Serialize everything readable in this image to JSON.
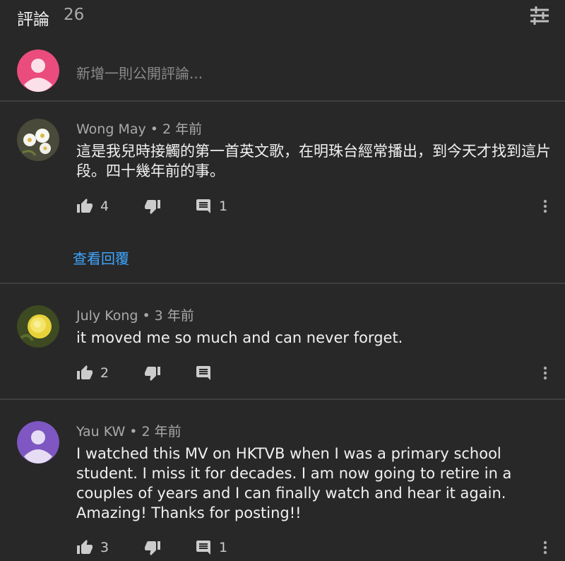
{
  "header": {
    "title": "評論",
    "count": "26"
  },
  "add_comment": {
    "placeholder": "新增一則公開評論..."
  },
  "comments": [
    {
      "author": "Wong May",
      "time": "2 年前",
      "text": "這是我兒時接觸的第一首英文歌，在明珠台經常播出，到今天才找到這片段。四十幾年前的事。",
      "likes": "4",
      "replies": "1",
      "view_replies": "查看回覆"
    },
    {
      "author": "July Kong",
      "time": "3 年前",
      "text": "it moved me so much and can never forget.",
      "likes": "2",
      "replies": ""
    },
    {
      "author": "Yau KW",
      "time": "2 年前",
      "text": "I watched this MV on HKTVB when I was a primary school student. I miss it for decades. I am now going to retire in a couples of years and I can finally watch and hear it again. Amazing! Thanks for posting!!",
      "likes": "3",
      "replies": "1"
    }
  ],
  "colors": {
    "background": "#282828",
    "link": "#3ea6ff",
    "pink_avatar": "#ea4c7e",
    "purple_avatar": "#7e57c2"
  }
}
